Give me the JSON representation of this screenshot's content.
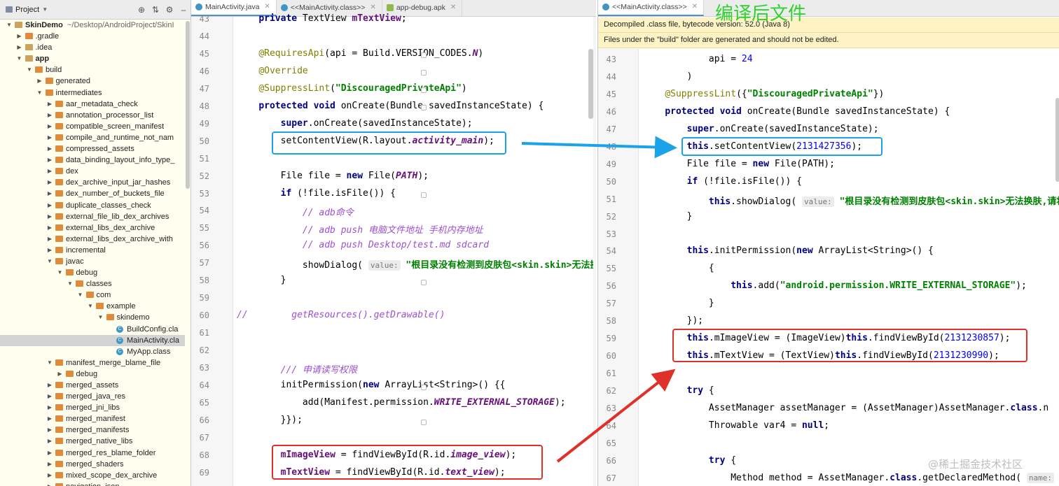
{
  "project_panel": {
    "title": "Project",
    "tree": [
      {
        "label": "SkinDemo",
        "suffix": "~/Desktop/AndroidProject/SkinI",
        "depth": 0,
        "icon": "folder",
        "arrow": "down",
        "bold": true
      },
      {
        "label": ".gradle",
        "depth": 1,
        "icon": "ofolder",
        "arrow": "right"
      },
      {
        "label": ".idea",
        "depth": 1,
        "icon": "folder",
        "arrow": "right"
      },
      {
        "label": "app",
        "depth": 1,
        "icon": "folder",
        "arrow": "down",
        "bold": true
      },
      {
        "label": "build",
        "depth": 2,
        "icon": "ofolder",
        "arrow": "down"
      },
      {
        "label": "generated",
        "depth": 3,
        "icon": "ofolder",
        "arrow": "right"
      },
      {
        "label": "intermediates",
        "depth": 3,
        "icon": "ofolder",
        "arrow": "down"
      },
      {
        "label": "aar_metadata_check",
        "depth": 4,
        "icon": "ofolder",
        "arrow": "right"
      },
      {
        "label": "annotation_processor_list",
        "depth": 4,
        "icon": "ofolder",
        "arrow": "right"
      },
      {
        "label": "compatible_screen_manifest",
        "depth": 4,
        "icon": "ofolder",
        "arrow": "right"
      },
      {
        "label": "compile_and_runtime_not_nam",
        "depth": 4,
        "icon": "ofolder",
        "arrow": "right"
      },
      {
        "label": "compressed_assets",
        "depth": 4,
        "icon": "ofolder",
        "arrow": "right"
      },
      {
        "label": "data_binding_layout_info_type_",
        "depth": 4,
        "icon": "ofolder",
        "arrow": "right"
      },
      {
        "label": "dex",
        "depth": 4,
        "icon": "ofolder",
        "arrow": "right"
      },
      {
        "label": "dex_archive_input_jar_hashes",
        "depth": 4,
        "icon": "ofolder",
        "arrow": "right"
      },
      {
        "label": "dex_number_of_buckets_file",
        "depth": 4,
        "icon": "ofolder",
        "arrow": "right"
      },
      {
        "label": "duplicate_classes_check",
        "depth": 4,
        "icon": "ofolder",
        "arrow": "right"
      },
      {
        "label": "external_file_lib_dex_archives",
        "depth": 4,
        "icon": "ofolder",
        "arrow": "right"
      },
      {
        "label": "external_libs_dex_archive",
        "depth": 4,
        "icon": "ofolder",
        "arrow": "right"
      },
      {
        "label": "external_libs_dex_archive_with",
        "depth": 4,
        "icon": "ofolder",
        "arrow": "right"
      },
      {
        "label": "incremental",
        "depth": 4,
        "icon": "ofolder",
        "arrow": "right"
      },
      {
        "label": "javac",
        "depth": 4,
        "icon": "ofolder",
        "arrow": "down"
      },
      {
        "label": "debug",
        "depth": 5,
        "icon": "ofolder",
        "arrow": "down"
      },
      {
        "label": "classes",
        "depth": 6,
        "icon": "ofolder",
        "arrow": "down"
      },
      {
        "label": "com",
        "depth": 7,
        "icon": "ofolder",
        "arrow": "down"
      },
      {
        "label": "example",
        "depth": 8,
        "icon": "ofolder",
        "arrow": "down"
      },
      {
        "label": "skindemo",
        "depth": 9,
        "icon": "ofolder",
        "arrow": "down"
      },
      {
        "label": "BuildConfig.cla",
        "depth": 10,
        "icon": "cls"
      },
      {
        "label": "MainActivity.cla",
        "depth": 10,
        "icon": "cls",
        "selected": true
      },
      {
        "label": "MyApp.class",
        "depth": 10,
        "icon": "cls"
      },
      {
        "label": "manifest_merge_blame_file",
        "depth": 4,
        "icon": "ofolder",
        "arrow": "down"
      },
      {
        "label": "debug",
        "depth": 5,
        "icon": "ofolder",
        "arrow": "right"
      },
      {
        "label": "merged_assets",
        "depth": 4,
        "icon": "ofolder",
        "arrow": "right"
      },
      {
        "label": "merged_java_res",
        "depth": 4,
        "icon": "ofolder",
        "arrow": "right"
      },
      {
        "label": "merged_jni_libs",
        "depth": 4,
        "icon": "ofolder",
        "arrow": "right"
      },
      {
        "label": "merged_manifest",
        "depth": 4,
        "icon": "ofolder",
        "arrow": "right"
      },
      {
        "label": "merged_manifests",
        "depth": 4,
        "icon": "ofolder",
        "arrow": "right"
      },
      {
        "label": "merged_native_libs",
        "depth": 4,
        "icon": "ofolder",
        "arrow": "right"
      },
      {
        "label": "merged_res_blame_folder",
        "depth": 4,
        "icon": "ofolder",
        "arrow": "right"
      },
      {
        "label": "merged_shaders",
        "depth": 4,
        "icon": "ofolder",
        "arrow": "right"
      },
      {
        "label": "mixed_scope_dex_archive",
        "depth": 4,
        "icon": "ofolder",
        "arrow": "right"
      },
      {
        "label": "navigation_json",
        "depth": 4,
        "icon": "ofolder",
        "arrow": "right"
      }
    ]
  },
  "left_editor": {
    "tabs": [
      {
        "label": "MainActivity.java",
        "icon": "class-icon",
        "active": true
      },
      {
        "label": "<<MainActivity.class>>",
        "icon": "class-icon",
        "active": false
      },
      {
        "label": "app-debug.apk",
        "icon": "apk-icon",
        "active": false
      }
    ],
    "lines": [
      {
        "n": "43",
        "html": "    <span class=\"kw\">private</span> TextView <span class=\"fld\">mTextView</span>;"
      },
      {
        "n": "44",
        "html": ""
      },
      {
        "n": "45",
        "html": "    <span class=\"ann\">@RequiresApi</span>(api = Build.VERSION_CODES.<span class=\"ifld\">N</span>)"
      },
      {
        "n": "46",
        "html": "    <span class=\"ann\">@Override</span>"
      },
      {
        "n": "47",
        "html": "    <span class=\"ann\">@SuppressLint</span>(<span class=\"str\">\"DiscouragedPrivateApi\"</span>)"
      },
      {
        "n": "48",
        "html": "    <span class=\"kw\">protected void</span> onCreate(Bundle savedInstanceState) {"
      },
      {
        "n": "49",
        "html": "        <span class=\"kw\">super</span>.onCreate(savedInstanceState);"
      },
      {
        "n": "50",
        "html": "        setContentView(R.layout.<span class=\"ifld\">activity_main</span>);"
      },
      {
        "n": "51",
        "html": ""
      },
      {
        "n": "52",
        "html": "        File file = <span class=\"kw\">new</span> File(<span class=\"ifld\">PATH</span>);"
      },
      {
        "n": "53",
        "html": "        <span class=\"kw\">if</span> (!file.isFile()) {"
      },
      {
        "n": "54",
        "html": "            <span class=\"cm2\">// adb命令</span>"
      },
      {
        "n": "55",
        "html": "            <span class=\"cm2\">// adb push 电脑文件地址 手机内存地址</span>"
      },
      {
        "n": "56",
        "html": "            <span class=\"cm2\">// adb push Desktop/test.md sdcard</span>"
      },
      {
        "n": "57",
        "html": "            showDialog( <span class=\"hint\">value:</span> <span class=\"str\">\"根目录没有检测到皮肤包&lt;skin.skin&gt;无法换肤</span>"
      },
      {
        "n": "58",
        "html": "        }"
      },
      {
        "n": "59",
        "html": ""
      },
      {
        "n": "60",
        "html": "<span class=\"cm2\">//        getResources().getDrawable()</span>"
      },
      {
        "n": "61",
        "html": ""
      },
      {
        "n": "62",
        "html": ""
      },
      {
        "n": "63",
        "html": "        <span class=\"cm2\">/// 申请读写权限</span>"
      },
      {
        "n": "64",
        "html": "        initPermission(<span class=\"kw\">new</span> ArrayList&lt;String&gt;() {{"
      },
      {
        "n": "65",
        "html": "            add(Manifest.permission.<span class=\"ifld\">WRITE_EXTERNAL_STORAGE</span>);"
      },
      {
        "n": "66",
        "html": "        }});"
      },
      {
        "n": "67",
        "html": ""
      },
      {
        "n": "68",
        "html": "        <span class=\"fld\">mImageView</span> = findViewById(R.id.<span class=\"ifld\">image_view</span>);"
      },
      {
        "n": "69",
        "html": "        <span class=\"fld\">mTextView</span> = findViewById(R.id.<span class=\"ifld\">text_view</span>);"
      }
    ]
  },
  "right_editor": {
    "tab": "<<MainActivity.class>>",
    "banner_1": "Decompiled .class file, bytecode version: 52.0 (Java 8)",
    "banner_2": "Files under the \"build\" folder are generated and should not be edited.",
    "overlay_title": "编译后文件",
    "lines": [
      {
        "n": "43",
        "html": "            api = <span class=\"num\">24</span>"
      },
      {
        "n": "44",
        "html": "        )"
      },
      {
        "n": "45",
        "html": "    <span class=\"ann\">@SuppressLint</span>({<span class=\"str\">\"DiscouragedPrivateApi\"</span>})"
      },
      {
        "n": "46",
        "html": "    <span class=\"kw\">protected void</span> onCreate(Bundle savedInstanceState) {"
      },
      {
        "n": "47",
        "html": "        <span class=\"kw\">super</span>.onCreate(savedInstanceState);"
      },
      {
        "n": "48",
        "html": "        <span class=\"kw\">this</span>.setContentView(<span class=\"num\">2131427356</span>);"
      },
      {
        "n": "49",
        "html": "        File file = <span class=\"kw\">new</span> File(PATH);"
      },
      {
        "n": "50",
        "html": "        <span class=\"kw\">if</span> (!file.isFile()) {"
      },
      {
        "n": "51",
        "html": "            <span class=\"kw\">this</span>.showDialog( <span class=\"hint\">value:</span> <span class=\"str\">\"根目录没有检测到皮肤包&lt;skin.skin&gt;无法换肤,请将</span>"
      },
      {
        "n": "52",
        "html": "        }"
      },
      {
        "n": "53",
        "html": ""
      },
      {
        "n": "54",
        "html": "        <span class=\"kw\">this</span>.initPermission(<span class=\"kw\">new</span> ArrayList&lt;String&gt;() {"
      },
      {
        "n": "55",
        "html": "            {"
      },
      {
        "n": "56",
        "html": "                <span class=\"kw\">this</span>.add(<span class=\"str\">\"android.permission.WRITE_EXTERNAL_STORAGE\"</span>);"
      },
      {
        "n": "57",
        "html": "            }"
      },
      {
        "n": "58",
        "html": "        });"
      },
      {
        "n": "59",
        "html": "        <span class=\"kw\">this</span>.mImageView = (ImageView)<span class=\"kw\">this</span>.findViewById(<span class=\"num\">2131230857</span>);"
      },
      {
        "n": "60",
        "html": "        <span class=\"kw\">this</span>.mTextView = (TextView)<span class=\"kw\">this</span>.findViewById(<span class=\"num\">2131230990</span>);"
      },
      {
        "n": "61",
        "html": ""
      },
      {
        "n": "62",
        "html": "        <span class=\"kw\">try</span> {"
      },
      {
        "n": "63",
        "html": "            AssetManager assetManager = (AssetManager)AssetManager.<span class=\"kw\">class</span>.n"
      },
      {
        "n": "64",
        "html": "            Throwable var4 = <span class=\"kw\">null</span>;"
      },
      {
        "n": "65",
        "html": ""
      },
      {
        "n": "66",
        "html": "            <span class=\"kw\">try</span> {"
      },
      {
        "n": "67",
        "html": "                Method method = AssetManager.<span class=\"kw\">class</span>.getDeclaredMethod( <span class=\"hint\">name:</span>"
      }
    ]
  },
  "watermark": "@稀土掘金技术社区",
  "colors": {
    "blue_box": "#1aa3e8",
    "red_box": "#e0302a",
    "title_green": "#2fd32f"
  }
}
